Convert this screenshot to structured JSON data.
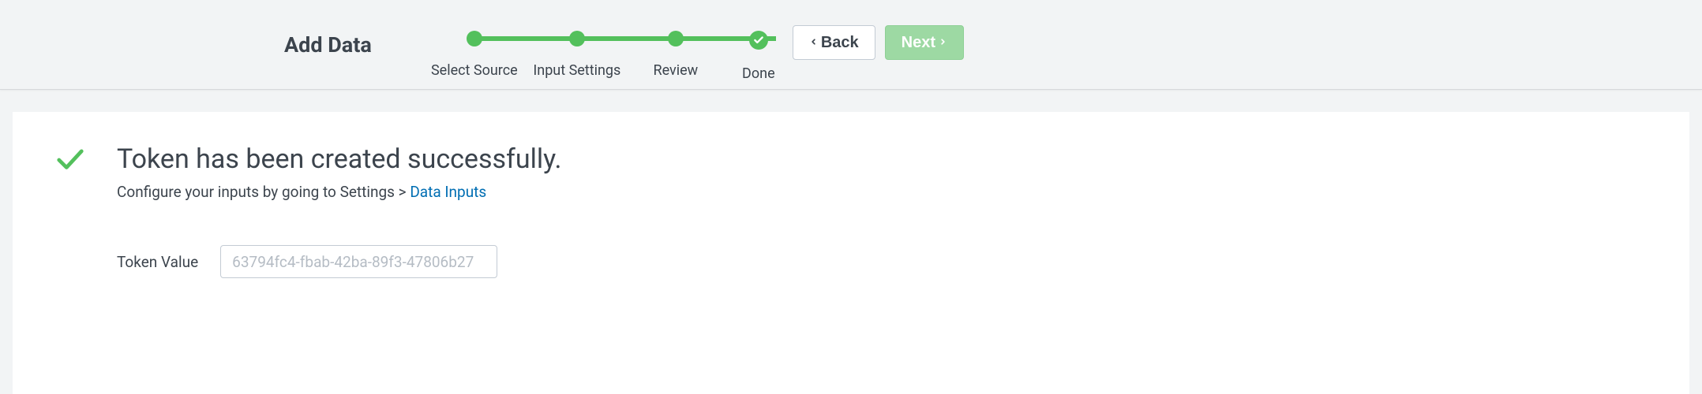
{
  "header": {
    "title": "Add Data",
    "steps": [
      {
        "label": "Select Source"
      },
      {
        "label": "Input Settings"
      },
      {
        "label": "Review"
      },
      {
        "label": "Done"
      }
    ],
    "back_label": "Back",
    "next_label": "Next"
  },
  "main": {
    "heading": "Token has been created successfully.",
    "subtext_prefix": "Configure your inputs by going to Settings > ",
    "subtext_link": "Data Inputs",
    "token_label": "Token Value",
    "token_value": "63794fc4-fbab-42ba-89f3-47806b27"
  }
}
